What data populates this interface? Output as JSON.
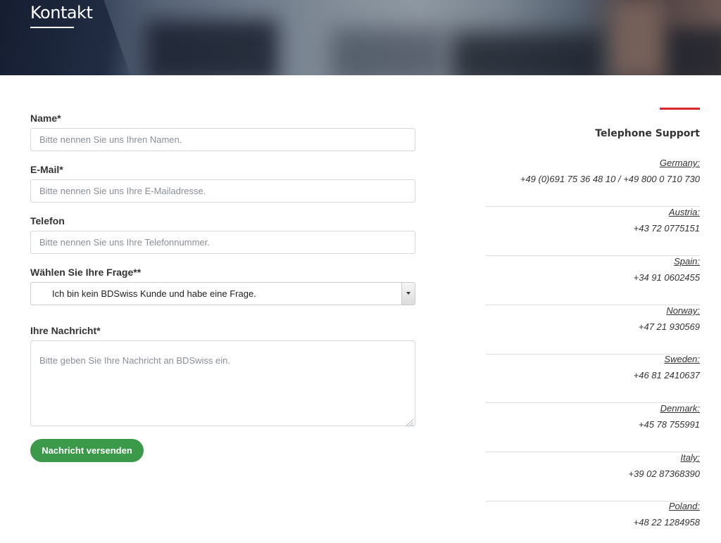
{
  "header": {
    "title": "Kontakt"
  },
  "form": {
    "name": {
      "label": "Name*",
      "placeholder": "Bitte nennen Sie uns Ihren Namen."
    },
    "email": {
      "label": "E-Mail*",
      "placeholder": "Bitte nennen Sie uns Ihre E-Mailadresse."
    },
    "phone": {
      "label": "Telefon",
      "placeholder": "Bitte nennen Sie uns Ihre Telefonnummer."
    },
    "question": {
      "label": "Wählen Sie Ihre Frage**",
      "selected": "Ich bin kein BDSwiss Kunde und habe eine Frage."
    },
    "message": {
      "label": "Ihre Nachricht*",
      "placeholder": "Bitte geben Sie Ihre Nachricht an BDSwiss ein."
    },
    "submit_label": "Nachricht versenden"
  },
  "support": {
    "title": "Telephone Support",
    "countries": [
      {
        "name": "Germany:",
        "phone": "+49 (0)691 75 36 48 10 / +49 800 0 710 730"
      },
      {
        "name": "Austria:",
        "phone": "+43 72 0775151"
      },
      {
        "name": "Spain:",
        "phone": "+34 91 0602455"
      },
      {
        "name": "Norway:",
        "phone": "+47 21 930569"
      },
      {
        "name": "Sweden:",
        "phone": "+46 81 2410637"
      },
      {
        "name": "Denmark:",
        "phone": "+45 78 755991"
      },
      {
        "name": "Italy:",
        "phone": "+39 02 87368390"
      },
      {
        "name": "Poland:",
        "phone": "+48 22 1284958"
      }
    ]
  },
  "colors": {
    "accent_green": "#3a9a4a",
    "accent_red": "#d9272e"
  }
}
